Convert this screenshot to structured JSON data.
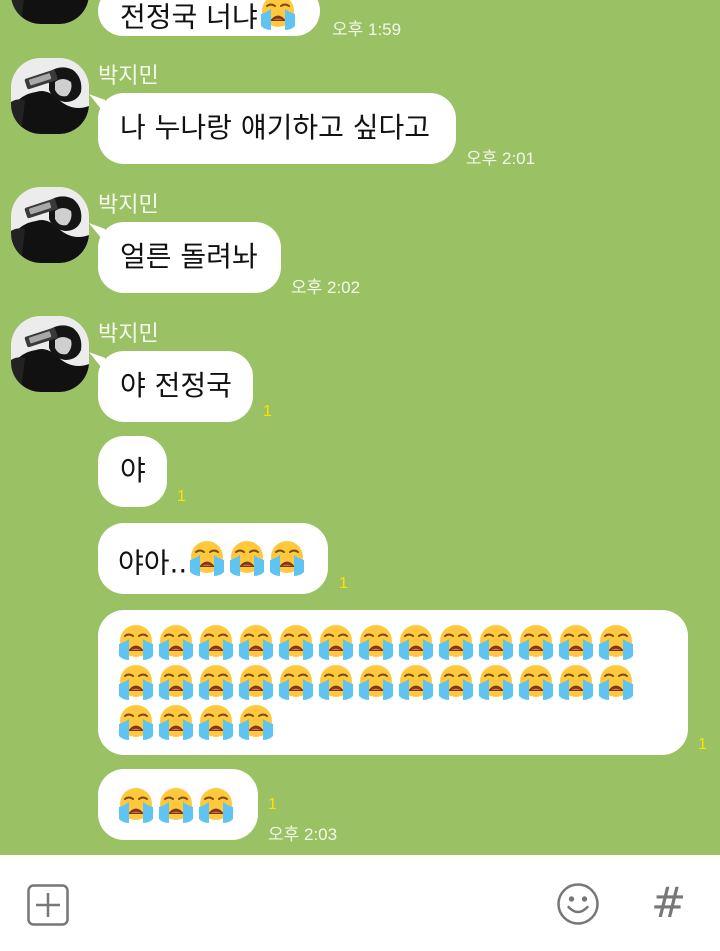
{
  "chat": {
    "messages": [
      {
        "id": "m0",
        "text": "전정국 너냐",
        "time": "오후 1:59"
      },
      {
        "id": "m1",
        "sender": "박지민",
        "text": "나 누나랑 얘기하고 싶다고",
        "time": "오후 2:01"
      },
      {
        "id": "m2",
        "sender": "박지민",
        "text": "얼른 돌려놔",
        "time": "오후 2:02"
      },
      {
        "id": "m3",
        "sender": "박지민",
        "text": "야 전정국",
        "unread": "1"
      },
      {
        "id": "m4",
        "text": "야",
        "unread": "1"
      },
      {
        "id": "m5",
        "text": "야아..",
        "emoji_count": 3,
        "unread": "1"
      },
      {
        "id": "m6",
        "emoji_count": 30,
        "unread": "1"
      },
      {
        "id": "m7",
        "emoji_count": 3,
        "unread": "1",
        "time": "오후 2:03"
      }
    ],
    "emoji": "loudly-crying-face"
  },
  "input_bar": {
    "attach_icon": "plus-box-icon",
    "emoticon_icon": "smiley-icon",
    "hashtag_icon": "hash-icon",
    "hashtag_label": "#"
  },
  "colors": {
    "background": "#9bc165",
    "bubble": "#ffffff",
    "unread": "#ffe100",
    "time": "#f4f8ea"
  }
}
